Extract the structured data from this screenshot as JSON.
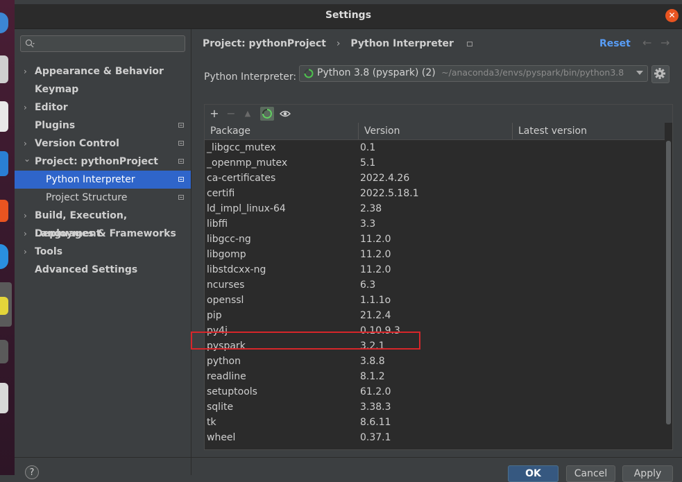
{
  "window": {
    "title": "Settings"
  },
  "sidebar": {
    "search_placeholder": "",
    "items": [
      {
        "label": "Appearance & Behavior",
        "expandable": true,
        "expanded": false,
        "sub": false
      },
      {
        "label": "Keymap",
        "expandable": false,
        "sub": false
      },
      {
        "label": "Editor",
        "expandable": true,
        "expanded": false,
        "sub": false
      },
      {
        "label": "Plugins",
        "expandable": false,
        "sub": false,
        "marker": true
      },
      {
        "label": "Version Control",
        "expandable": true,
        "expanded": false,
        "sub": false,
        "marker": true
      },
      {
        "label": "Project: pythonProject",
        "expandable": true,
        "expanded": true,
        "sub": false,
        "marker": true
      },
      {
        "label": "Python Interpreter",
        "sub": true,
        "selected": true,
        "marker": true
      },
      {
        "label": "Project Structure",
        "sub": true,
        "marker": true
      },
      {
        "label": "Build, Execution, Deployment",
        "expandable": true,
        "expanded": false,
        "sub": false
      },
      {
        "label": "Languages & Frameworks",
        "expandable": true,
        "expanded": false,
        "sub": false
      },
      {
        "label": "Tools",
        "expandable": true,
        "expanded": false,
        "sub": false
      },
      {
        "label": "Advanced Settings",
        "expandable": false,
        "sub": false
      }
    ]
  },
  "main": {
    "breadcrumb": {
      "project": "Project: pythonProject",
      "separator": "›",
      "page": "Python Interpreter"
    },
    "reset_label": "Reset",
    "back_arrow": "←",
    "forward_arrow": "→",
    "interpreter": {
      "label": "Python Interpreter:",
      "name": "Python 3.8 (pyspark) (2)",
      "path": "~/anaconda3/envs/pyspark/bin/python3.8"
    },
    "toolbar": {
      "add": "+",
      "remove": "−",
      "upgrade": "▲"
    },
    "table": {
      "columns": [
        "Package",
        "Version",
        "Latest version"
      ],
      "rows": [
        {
          "package": "_libgcc_mutex",
          "version": "0.1",
          "latest": ""
        },
        {
          "package": "_openmp_mutex",
          "version": "5.1",
          "latest": ""
        },
        {
          "package": "ca-certificates",
          "version": "2022.4.26",
          "latest": ""
        },
        {
          "package": "certifi",
          "version": "2022.5.18.1",
          "latest": ""
        },
        {
          "package": "ld_impl_linux-64",
          "version": "2.38",
          "latest": ""
        },
        {
          "package": "libffi",
          "version": "3.3",
          "latest": ""
        },
        {
          "package": "libgcc-ng",
          "version": "11.2.0",
          "latest": ""
        },
        {
          "package": "libgomp",
          "version": "11.2.0",
          "latest": ""
        },
        {
          "package": "libstdcxx-ng",
          "version": "11.2.0",
          "latest": ""
        },
        {
          "package": "ncurses",
          "version": "6.3",
          "latest": ""
        },
        {
          "package": "openssl",
          "version": "1.1.1o",
          "latest": ""
        },
        {
          "package": "pip",
          "version": "21.2.4",
          "latest": ""
        },
        {
          "package": "py4j",
          "version": "0.10.9.3",
          "latest": ""
        },
        {
          "package": "pyspark",
          "version": "3.2.1",
          "latest": ""
        },
        {
          "package": "python",
          "version": "3.8.8",
          "latest": ""
        },
        {
          "package": "readline",
          "version": "8.1.2",
          "latest": ""
        },
        {
          "package": "setuptools",
          "version": "61.2.0",
          "latest": ""
        },
        {
          "package": "sqlite",
          "version": "3.38.3",
          "latest": ""
        },
        {
          "package": "tk",
          "version": "8.6.11",
          "latest": ""
        },
        {
          "package": "wheel",
          "version": "0.37.1",
          "latest": ""
        }
      ]
    },
    "highlighted_package": "pyspark"
  },
  "footer": {
    "help": "?",
    "ok": "OK",
    "cancel": "Cancel",
    "apply": "Apply"
  },
  "colors": {
    "accent": "#2f65ca",
    "link": "#589df6",
    "highlight_border": "#d7262a",
    "close": "#e95420"
  }
}
